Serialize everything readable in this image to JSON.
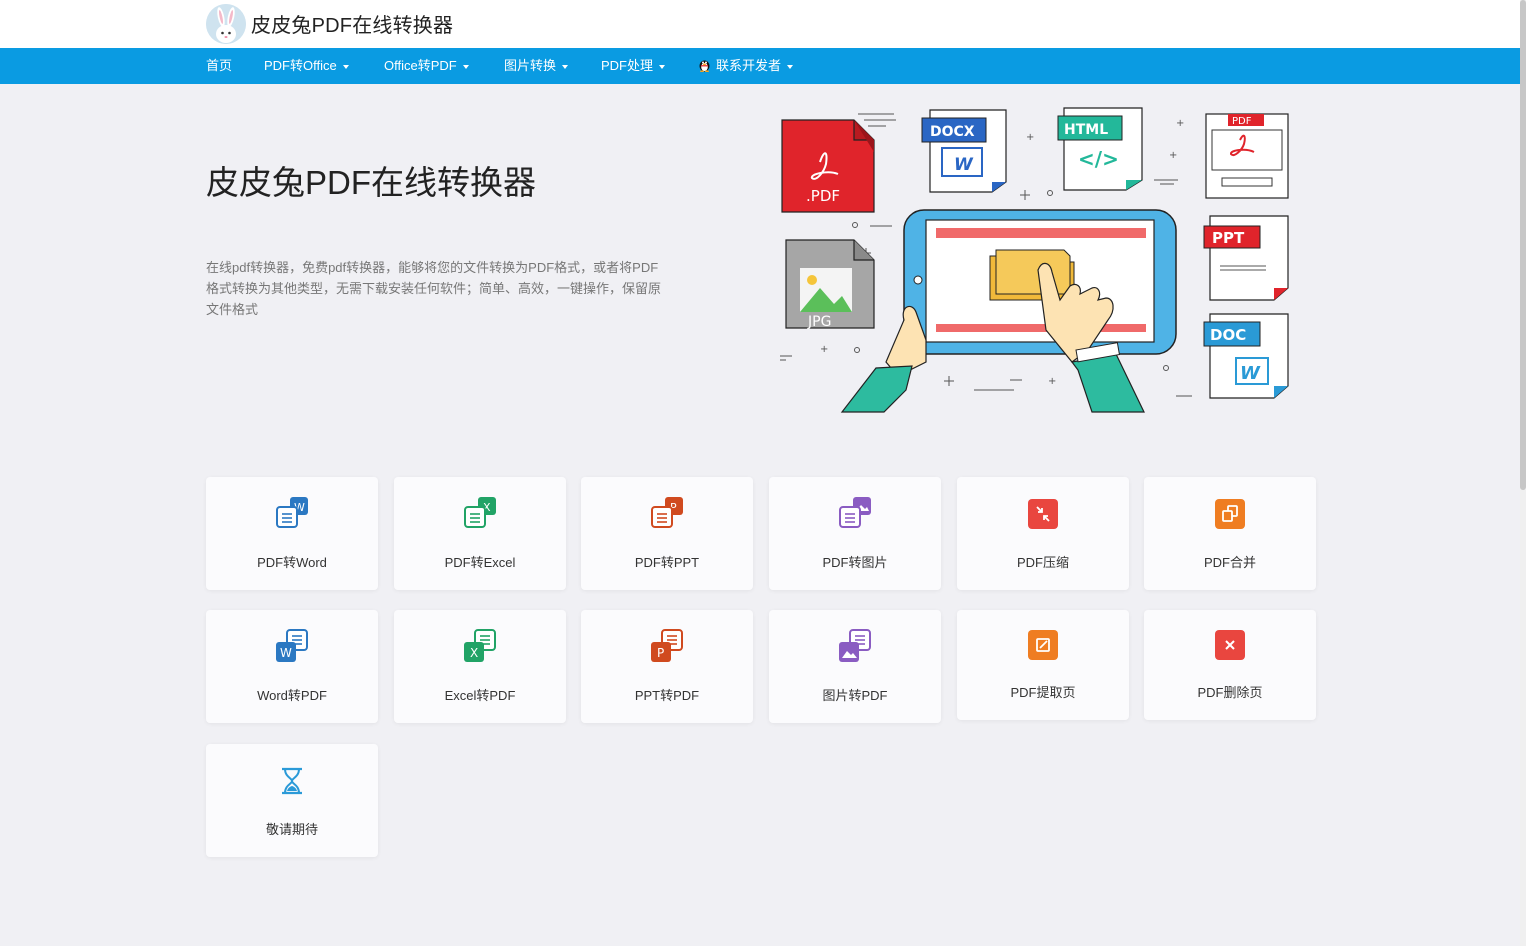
{
  "header": {
    "brand": "皮皮兔PDF在线转换器"
  },
  "nav": {
    "items": [
      {
        "label": "首页",
        "dropdown": false
      },
      {
        "label": "PDF转Office",
        "dropdown": true
      },
      {
        "label": "Office转PDF",
        "dropdown": true
      },
      {
        "label": "图片转换",
        "dropdown": true
      },
      {
        "label": "PDF处理",
        "dropdown": true
      },
      {
        "label": "联系开发者",
        "dropdown": true,
        "icon": "qq-penguin-icon"
      }
    ]
  },
  "hero": {
    "title": "皮皮兔PDF在线转换器",
    "description": "在线pdf转换器，免费pdf转换器，能够将您的文件转换为PDF格式，或者将PDF格式转换为其他类型，无需下载安装任何软件；简单、高效，一键操作，保留原文件格式",
    "illustration": {
      "pdf_label": ".PDF",
      "jpg_label": "JPG",
      "docx_label": "DOCX",
      "html_label": "HTML",
      "html_code": "</>",
      "pdf_tag": "PDF",
      "ppt_tag": "PPT",
      "doc_tag": "DOC",
      "word_letter": "W"
    }
  },
  "tools": [
    {
      "label": "PDF转Word",
      "icon": "pdf-to-word-icon",
      "color": "#2b78c2",
      "letter": "W"
    },
    {
      "label": "PDF转Excel",
      "icon": "pdf-to-excel-icon",
      "color": "#21a366",
      "letter": "X"
    },
    {
      "label": "PDF转PPT",
      "icon": "pdf-to-ppt-icon",
      "color": "#d04a1f",
      "letter": "P"
    },
    {
      "label": "PDF转图片",
      "icon": "pdf-to-image-icon",
      "color": "#8a5cc2",
      "letter": ""
    },
    {
      "label": "PDF压缩",
      "icon": "pdf-compress-icon",
      "color": "#e9463f",
      "letter": ""
    },
    {
      "label": "PDF合并",
      "icon": "pdf-merge-icon",
      "color": "#ef7d22",
      "letter": ""
    },
    {
      "label": "Word转PDF",
      "icon": "word-to-pdf-icon",
      "color": "#2b78c2",
      "letter": "W"
    },
    {
      "label": "Excel转PDF",
      "icon": "excel-to-pdf-icon",
      "color": "#21a366",
      "letter": "X"
    },
    {
      "label": "PPT转PDF",
      "icon": "ppt-to-pdf-icon",
      "color": "#d04a1f",
      "letter": "P"
    },
    {
      "label": "图片转PDF",
      "icon": "image-to-pdf-icon",
      "color": "#8a5cc2",
      "letter": ""
    },
    {
      "label": "PDF提取页",
      "icon": "pdf-extract-icon",
      "color": "#ef7d22",
      "letter": ""
    },
    {
      "label": "PDF删除页",
      "icon": "pdf-delete-icon",
      "color": "#e9463f",
      "letter": ""
    },
    {
      "label": "敬请期待",
      "icon": "hourglass-icon",
      "color": "#2b9ad8",
      "letter": ""
    }
  ]
}
